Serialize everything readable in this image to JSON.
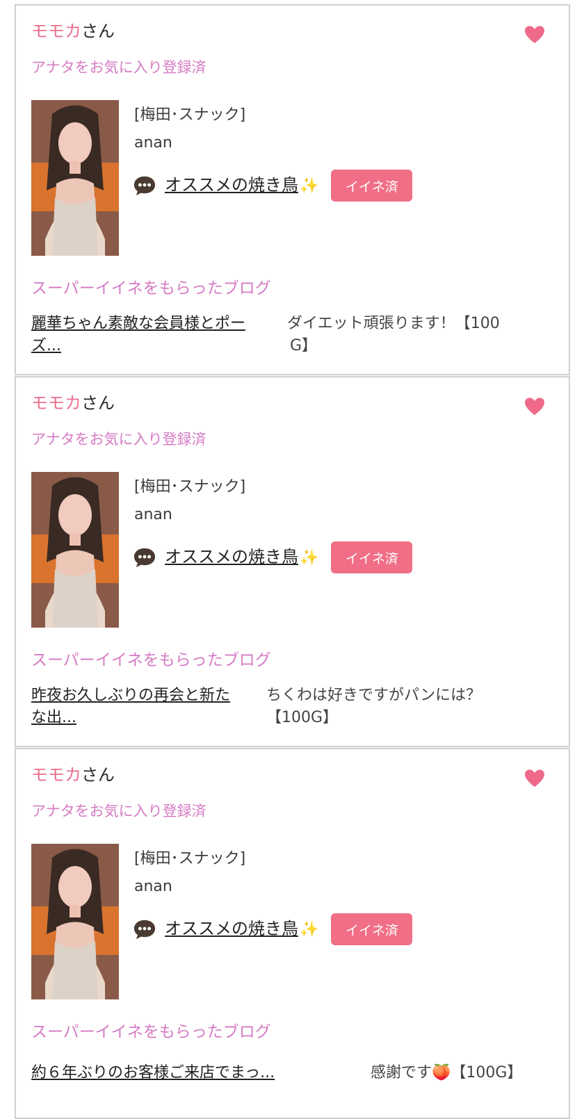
{
  "cards": [
    {
      "name": "モモカ",
      "name_suffix": "さん",
      "favorite_note": "アナタをお気に入り登録済",
      "shop": "[梅田･スナック]",
      "cast_name": "anan",
      "blog_title": "オススメの焼き鳥",
      "blog_sparkle": "✨",
      "iine_label": "イイネ済",
      "super_title": "スーパーイイネをもらったブログ",
      "super_blog_line1": "麗華ちゃん素敵な会員様とポー",
      "super_blog_line2": "ズ...",
      "super_comment_line1": "ダイエット頑張ります！【100",
      "super_comment_line2": "G】"
    },
    {
      "name": "モモカ",
      "name_suffix": "さん",
      "favorite_note": "アナタをお気に入り登録済",
      "shop": "[梅田･スナック]",
      "cast_name": "anan",
      "blog_title": "オススメの焼き鳥",
      "blog_sparkle": "✨",
      "iine_label": "イイネ済",
      "super_title": "スーパーイイネをもらったブログ",
      "super_blog_line1": "昨夜お久しぶりの再会と新た",
      "super_blog_line2": "な出...",
      "super_comment_line1": "ちくわは好きですがパンには？",
      "super_comment_line2": "【100G】"
    },
    {
      "name": "モモカ",
      "name_suffix": "さん",
      "favorite_note": "アナタをお気に入り登録済",
      "shop": "[梅田･スナック]",
      "cast_name": "anan",
      "blog_title": "オススメの焼き鳥",
      "blog_sparkle": "✨",
      "iine_label": "イイネ済",
      "super_title": "スーパーイイネをもらったブログ",
      "super_blog_line1": "約６年ぶりのお客様ご来店でまっ...",
      "super_blog_line2": "",
      "super_comment_line1": "感謝です🍑【100G】",
      "super_comment_line2": ""
    }
  ],
  "icons": {
    "favorite": "heart-icon",
    "blog": "speech-bubble-icon"
  },
  "colors": {
    "accent_pink": "#e8708e",
    "button_pink": "#f06f86",
    "label_magenta": "#d67bc4",
    "border": "#cfcfcf"
  }
}
